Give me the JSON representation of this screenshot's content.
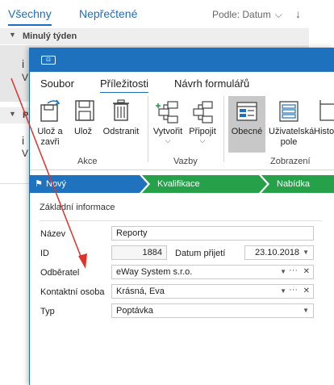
{
  "mail": {
    "tab_all": "Všechny",
    "tab_unread": "Nepřečtené",
    "sort_label": "Podle: Datum",
    "group_last_week": "Minulý týden",
    "group_second": "P",
    "item1_line1": "i",
    "item1_line2": "V",
    "item2_line1": "i",
    "item2_line2": "V"
  },
  "window": {
    "icon_text": "⊡"
  },
  "menu": {
    "file": "Soubor",
    "opportunity": "Příležitosti",
    "form_design": "Návrh formulářů"
  },
  "ribbon": {
    "save_close": "Ulož a zavři",
    "save": "Ulož",
    "delete": "Odstranit",
    "group_actions": "Akce",
    "create": "Vytvořit",
    "attach": "Připojit",
    "group_links": "Vazby",
    "general": "Obecné",
    "user_field": "Uživatelská pole",
    "history": "Histo",
    "group_view": "Zobrazení"
  },
  "stages": {
    "new": "Nový",
    "qualification": "Kvalifikace",
    "offer": "Nabídka"
  },
  "form": {
    "section": "Základní informace",
    "name_label": "Název",
    "name_value": "Reporty",
    "id_label": "ID",
    "id_value": "1884",
    "date_label": "Datum přijetí",
    "date_value": "23.10.2018",
    "customer_label": "Odběratel",
    "customer_value": "eWay System s.r.o.",
    "contact_label": "Kontaktní osoba",
    "contact_value": "Krásná, Eva",
    "type_label": "Typ",
    "type_value": "Poptávka"
  },
  "colors": {
    "accent": "#1e72bd",
    "stage_new": "#1f72be",
    "stage_done": "#27a04a",
    "arrow": "#e0312b"
  }
}
